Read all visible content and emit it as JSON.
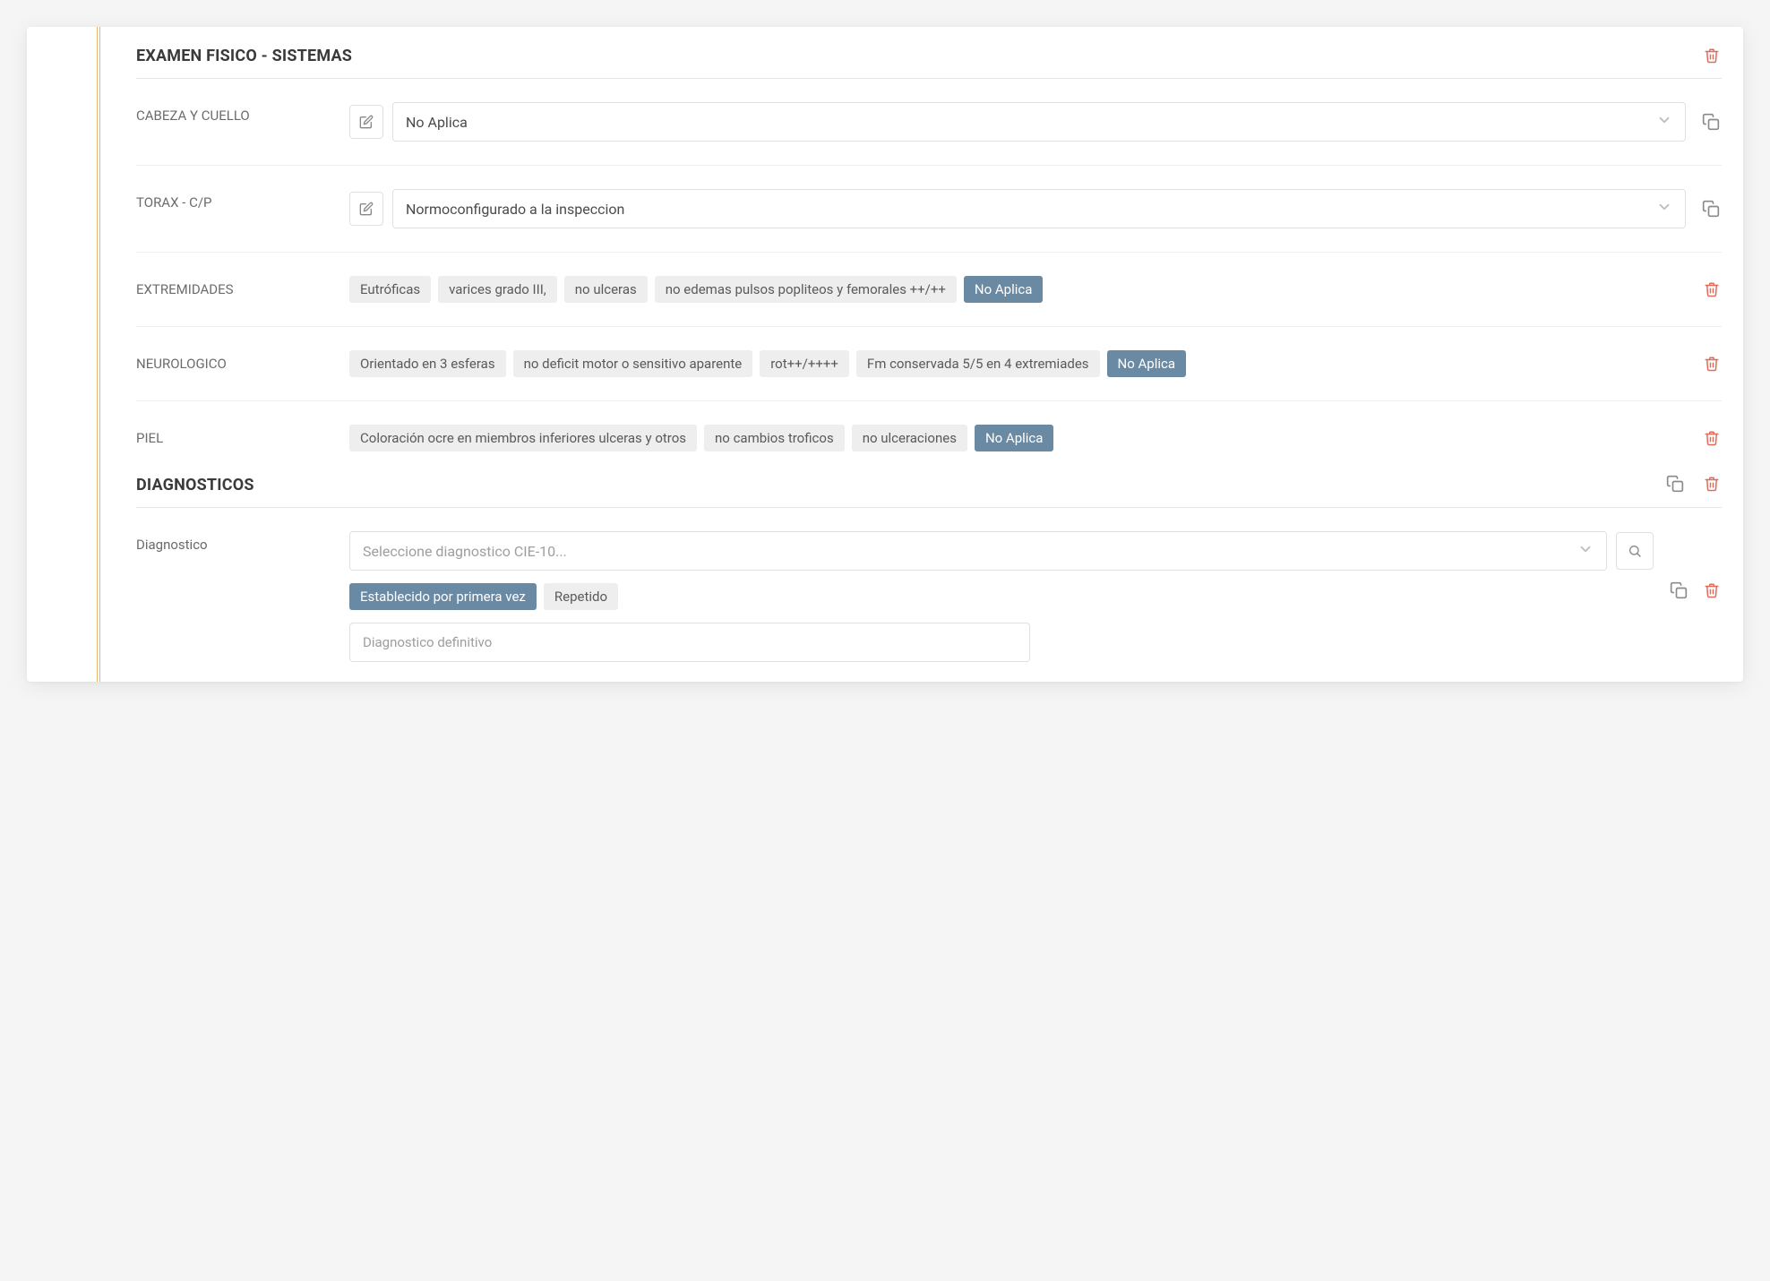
{
  "section_examen": {
    "title": "EXAMEN FISICO - SISTEMAS",
    "rows": {
      "cabeza": {
        "label": "CABEZA Y CUELLO",
        "value": "No Aplica"
      },
      "torax": {
        "label": "TORAX - C/P",
        "value": "Normoconfigurado a la inspeccion"
      },
      "extremidades": {
        "label": "EXTREMIDADES",
        "tags": [
          "Eutróficas",
          "varices grado III,",
          "no ulceras",
          "no edemas pulsos popliteos y femorales ++/++"
        ],
        "active": "No Aplica"
      },
      "neurologico": {
        "label": "NEUROLOGICO",
        "tags": [
          "Orientado en 3 esferas",
          "no deficit motor o sensitivo aparente",
          "rot++/++++",
          "Fm conservada 5/5 en 4 extremiades"
        ],
        "active": "No Aplica"
      },
      "piel": {
        "label": "PIEL",
        "tags": [
          "Coloración ocre en miembros inferiores ulceras y otros",
          "no cambios troficos",
          "no ulceraciones"
        ],
        "active": "No Aplica"
      }
    }
  },
  "section_diag": {
    "title": "DIAGNOSTICOS",
    "row_label": "Diagnostico",
    "select_placeholder": "Seleccione diagnostico CIE-10...",
    "pills": {
      "active": "Establecido por primera vez",
      "other": "Repetido"
    },
    "input_placeholder": "Diagnostico definitivo"
  }
}
